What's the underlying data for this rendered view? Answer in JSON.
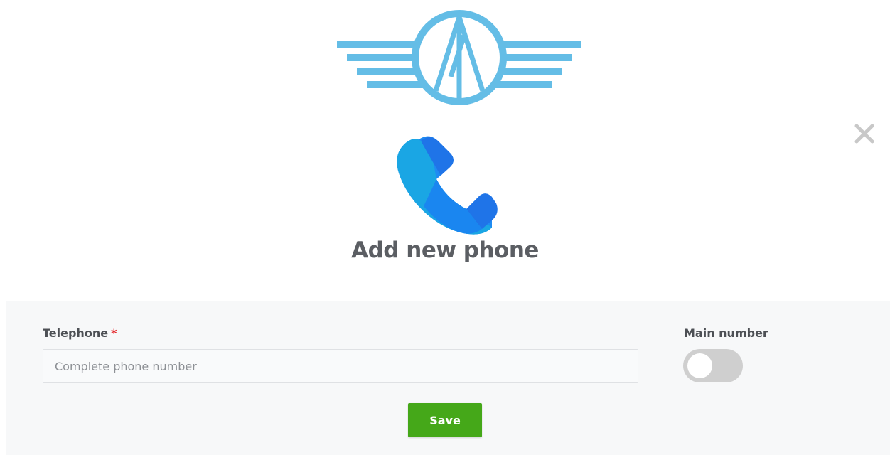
{
  "header": {
    "logo_icon": "winged-circle-logo-icon",
    "close_icon": "close-icon",
    "phone_icon": "phone-handset-icon",
    "title": "Add new phone"
  },
  "form": {
    "telephone_label": "Telephone",
    "required_marker": "*",
    "telephone_placeholder": "Complete phone number",
    "telephone_value": "",
    "main_number_label": "Main number",
    "main_number_on": false,
    "save_label": "Save"
  },
  "colors": {
    "logo": "#64bde6",
    "accent_green": "#45a819",
    "required": "#e5282c",
    "phone_light": "#1aa6e4",
    "phone_dark": "#1f74e8"
  }
}
